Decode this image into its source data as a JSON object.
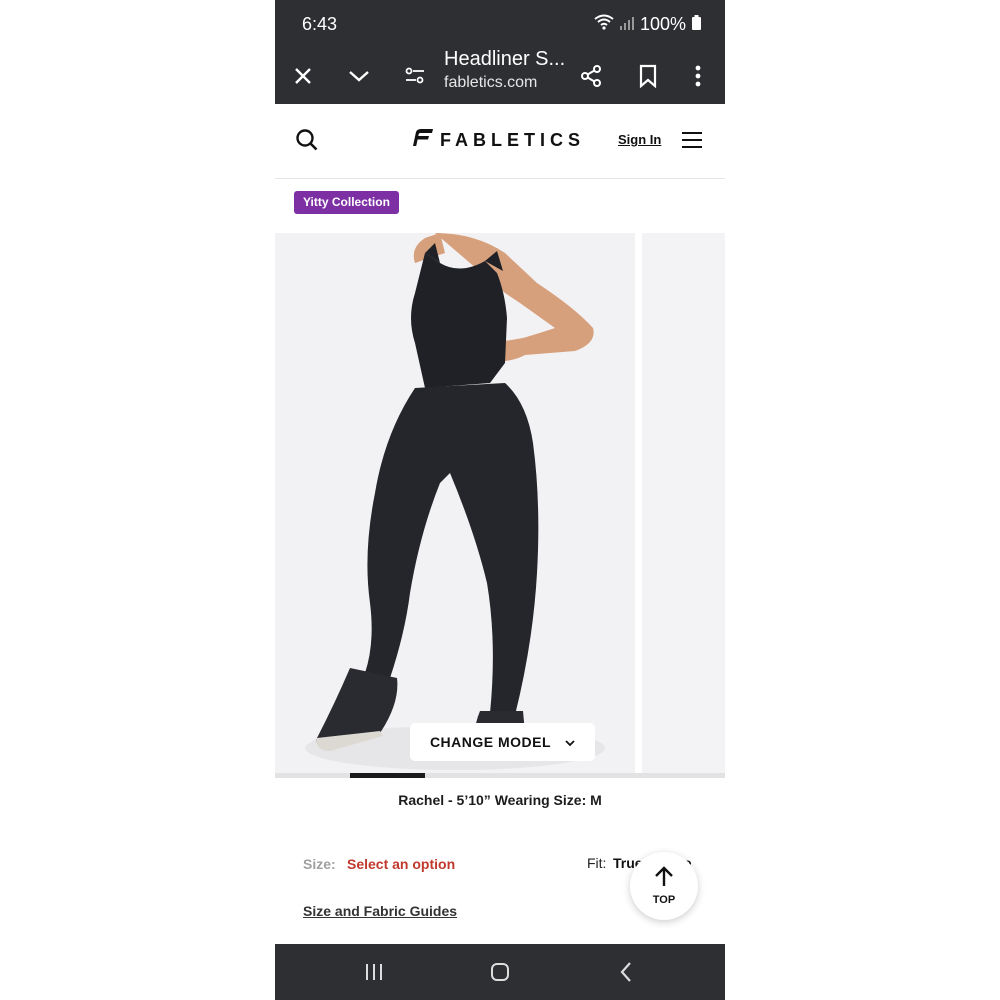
{
  "status_bar": {
    "time": "6:43",
    "battery": "100%"
  },
  "browser": {
    "page_title": "Headliner S...",
    "url": "fabletics.com"
  },
  "site_header": {
    "brand": "FABLETICS",
    "sign_in": "Sign In"
  },
  "product": {
    "collection_badge": "Yitty Collection",
    "change_model_label": "CHANGE MODEL",
    "model_info": "Rachel - 5’10” Wearing Size: M",
    "size_label": "Size:",
    "size_value": "Select an option",
    "fit_label": "Fit:",
    "fit_value": "True to Size",
    "guides_link": "Size and Fabric Guides",
    "top_button_label": "TOP",
    "image_gallery": {
      "current_index": 2,
      "total_images": 6
    }
  },
  "colors": {
    "chrome_bg": "#2e2f33",
    "badge_purple": "#7d2fa4",
    "size_prompt_red": "#c0392b"
  },
  "icons": {
    "toolbar": [
      "close-icon",
      "chevron-down-icon",
      "page-settings-icon",
      "share-icon",
      "bookmark-icon",
      "more-vert-icon"
    ],
    "header": [
      "search-icon",
      "fabletics-logo-icon",
      "hamburger-menu-icon"
    ],
    "nav": [
      "recent-apps-icon",
      "home-icon",
      "back-icon"
    ]
  }
}
